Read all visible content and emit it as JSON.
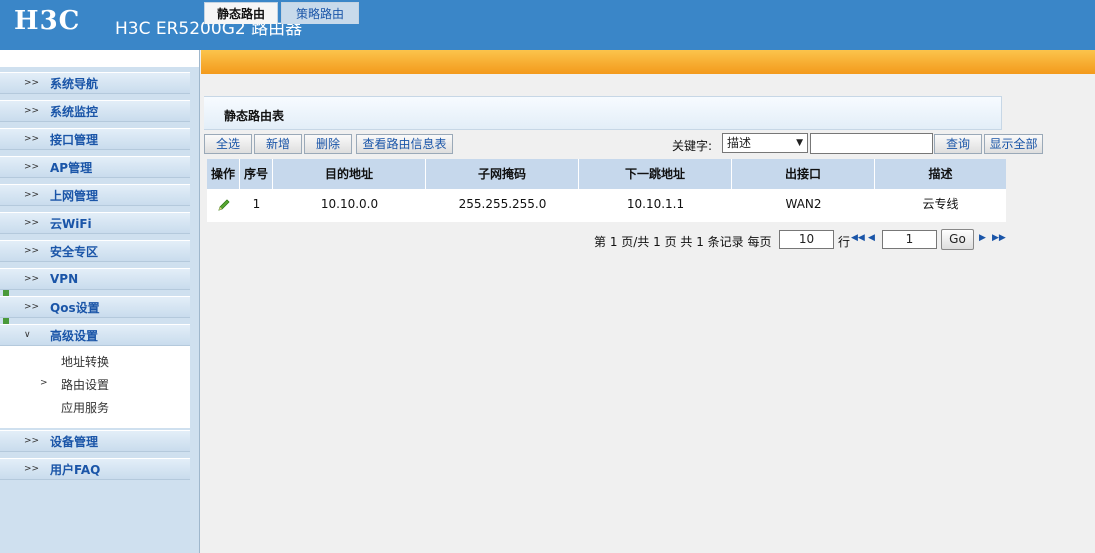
{
  "header": {
    "logo": "H3C",
    "title": "H3C ER5200G2 路由器"
  },
  "sidebar": {
    "items": [
      {
        "label": "系统导航"
      },
      {
        "label": "系统监控"
      },
      {
        "label": "接口管理"
      },
      {
        "label": "AP管理"
      },
      {
        "label": "上网管理"
      },
      {
        "label": "云WiFi"
      },
      {
        "label": "安全专区"
      },
      {
        "label": "VPN"
      },
      {
        "label": "Qos设置"
      },
      {
        "label": "高级设置"
      },
      {
        "label": "设备管理"
      },
      {
        "label": "用户FAQ"
      }
    ],
    "sub_items": [
      {
        "label": "地址转换"
      },
      {
        "label": "路由设置"
      },
      {
        "label": "应用服务"
      }
    ]
  },
  "tabs": [
    {
      "label": "静态路由",
      "active": true
    },
    {
      "label": "策略路由",
      "active": false
    }
  ],
  "panel": {
    "title": "静态路由表"
  },
  "toolbar": {
    "select_all": "全选",
    "add": "新增",
    "delete": "删除",
    "view_route_info": "查看路由信息表",
    "keyword_label": "关键字:",
    "keyword_select_value": "描述",
    "search": "查询",
    "show_all": "显示全部"
  },
  "table": {
    "headers": [
      "操作",
      "序号",
      "目的地址",
      "子网掩码",
      "下一跳地址",
      "出接口",
      "描述"
    ],
    "rows": [
      {
        "index": "1",
        "dest": "10.10.0.0",
        "mask": "255.255.255.0",
        "next_hop": "10.10.1.1",
        "iface": "WAN2",
        "desc": "云专线"
      }
    ]
  },
  "pager": {
    "summary": "第 1 页/共 1 页 共 1 条记录 每页",
    "per_page": "10",
    "rows_unit": "行",
    "page_value": "1",
    "go": "Go"
  },
  "colors": {
    "header_bg": "#3a86c8",
    "tab_bar": "#f39a1c",
    "link_blue": "#1a55a8",
    "table_header": "#c6d8ec"
  },
  "icons": [
    "pencil-edit-icon",
    "first-page-icon",
    "prev-page-icon",
    "next-page-icon",
    "last-page-icon",
    "expand-arrow-icon"
  ]
}
